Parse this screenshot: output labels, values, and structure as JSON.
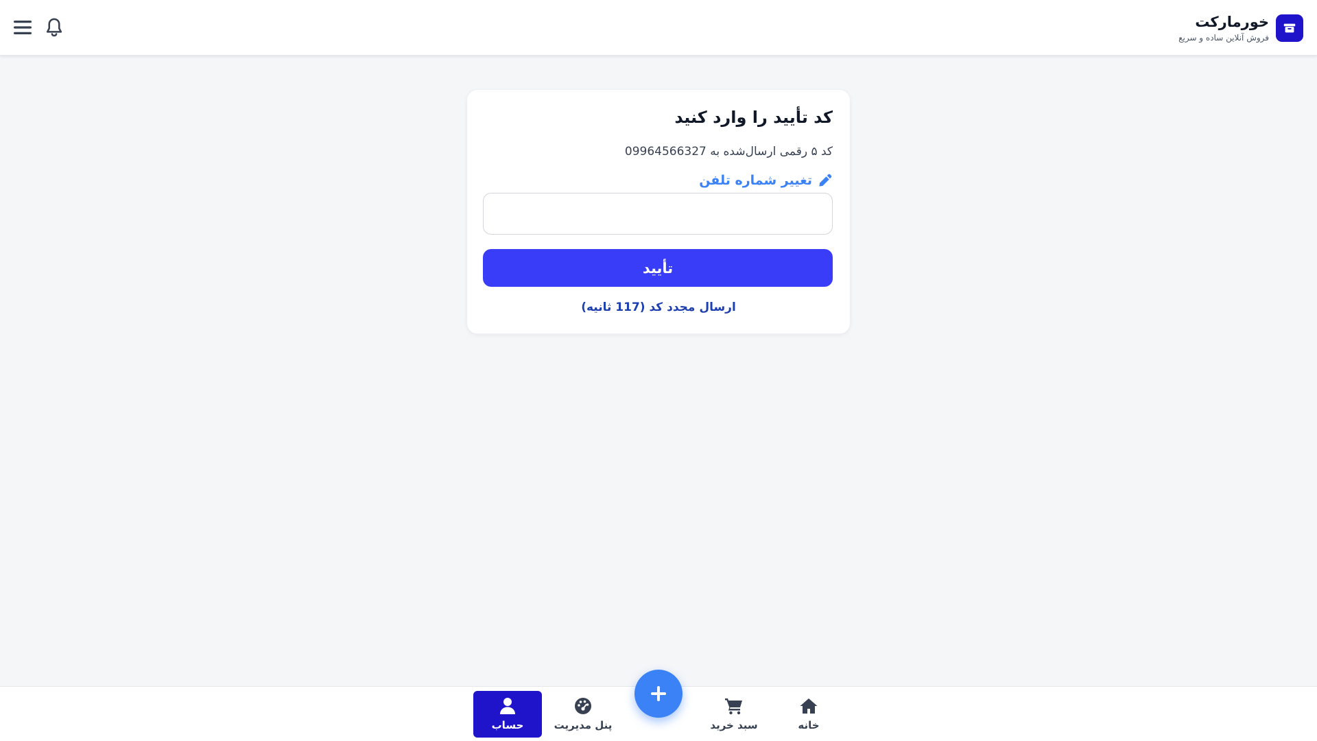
{
  "header": {
    "brand_title": "خورمارکت",
    "brand_subtitle": "فروش آنلاین ساده و سریع",
    "logo_icon": "store-icon",
    "menu_icon": "hamburger-menu-icon",
    "bell_icon": "bell-icon"
  },
  "verify": {
    "title": "کد تأیید را وارد کنید",
    "description": "کد ۵ رقمی ارسال‌شده به 09964566327",
    "change_phone_label": "تغییر شماره تلفن",
    "code_value": "",
    "code_placeholder": "",
    "confirm_label": "تأیید",
    "resend_label": "ارسال مجدد کد (117 ثانیه)"
  },
  "bottom_nav": {
    "items": [
      {
        "label": "خانه",
        "icon": "home-icon"
      },
      {
        "label": "سبد خرید",
        "icon": "shopping-cart-icon"
      },
      {
        "label": "پنل مدیریت",
        "icon": "dashboard-gauge-icon"
      },
      {
        "label": "حساب",
        "icon": "user-icon",
        "active": true
      }
    ],
    "fab_icon": "plus-icon"
  },
  "colors": {
    "brand": "#1f14c9",
    "primary_button": "#3a3df7",
    "link": "#3b82f6",
    "background": "#f5f6f8"
  }
}
